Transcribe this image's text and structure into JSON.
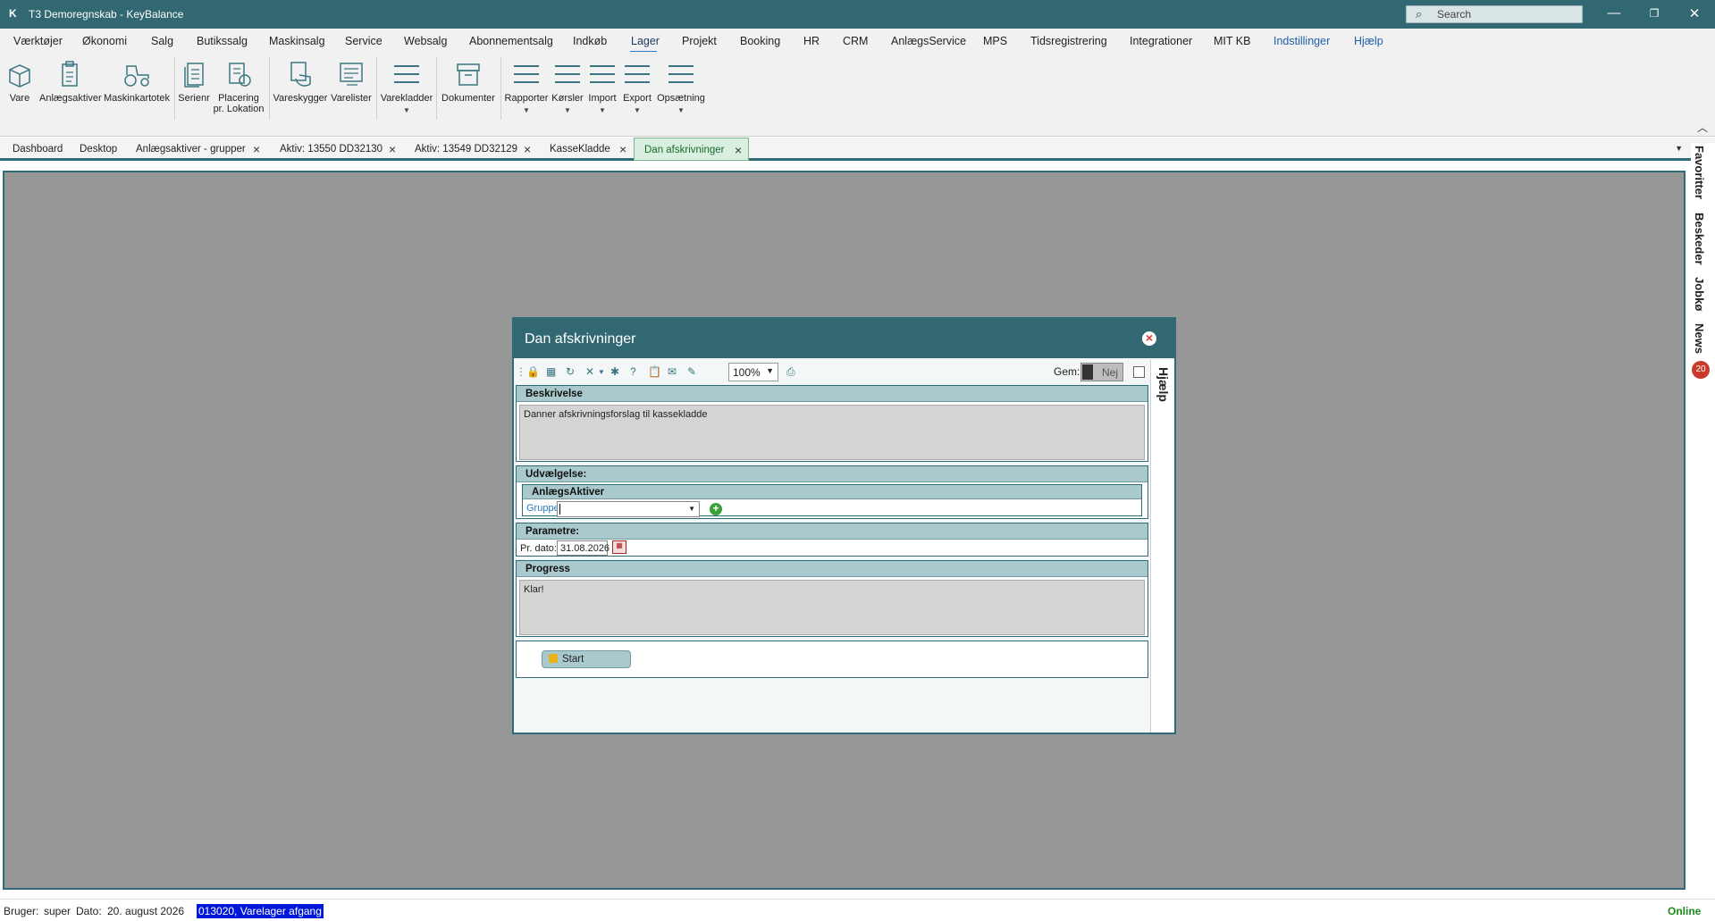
{
  "window": {
    "title": "T3 Demoregnskab - KeyBalance",
    "logo": "K",
    "search_placeholder": "Search"
  },
  "menu": [
    "Værktøjer",
    "Økonomi",
    "Salg",
    "Butikssalg",
    "Maskinsalg",
    "Service",
    "Websalg",
    "Abonnementsalg",
    "Indkøb",
    "Lager",
    "Projekt",
    "Booking",
    "HR",
    "CRM",
    "AnlægsService",
    "MPS",
    "Tidsregistrering",
    "Integrationer",
    "MIT KB",
    "Indstillinger",
    "Hjælp"
  ],
  "menu_active": "Lager",
  "ribbon": {
    "vare": "Vare",
    "anlaegsaktiver": "Anlægsaktiver",
    "maskinkartotek": "Maskinkartotek",
    "serienr": "Serienr",
    "placering_1": "Placering",
    "placering_2": "pr. Lokation",
    "vareskygger": "Vareskygger",
    "varelister": "Varelister",
    "varekladder": "Varekladder",
    "dokumenter": "Dokumenter",
    "rapporter": "Rapporter",
    "koersler": "Kørsler",
    "import": "Import",
    "export": "Export",
    "opsaetning": "Opsætning"
  },
  "tabs": [
    "Dashboard",
    "Desktop",
    "Anlægsaktiver - grupper",
    "Aktiv: 13550 DD32130",
    "Aktiv: 13549 DD32129",
    "KasseKladde",
    "Dan afskrivninger"
  ],
  "right_rail": {
    "favoritter": "Favoritter",
    "beskeder": "Beskeder",
    "jobkoe": "Jobkø",
    "news": "News",
    "news_count": "20"
  },
  "dialog": {
    "title": "Dan afskrivninger",
    "zoom": "100%",
    "gem_label": "Gem:",
    "gem_toggle": "Nej",
    "help": "Hjælp",
    "beskrivelse_header": "Beskrivelse",
    "beskrivelse_text": "Danner afskrivningsforslag til kassekladde",
    "udvaelgelse_header": "Udvælgelse:",
    "anlaegsaktiver_header": "AnlægsAktiver",
    "gruppe_label": "Gruppe:",
    "parametre_header": "Parametre:",
    "prdato_label": "Pr. dato:",
    "prdato_value": "31.08.2026",
    "progress_header": "Progress",
    "progress_text": "Klar!",
    "start_label": "Start"
  },
  "status": {
    "bruger_label": "Bruger:",
    "bruger": "super",
    "dato_label": "Dato:",
    "dato": "20. august 2026",
    "selection": "013020, Varelager afgang",
    "online": "Online"
  },
  "colors": {
    "accent": "#316872",
    "section_header": "#a9c9cc",
    "workspace": "#979797",
    "online": "#1a8a1a"
  }
}
